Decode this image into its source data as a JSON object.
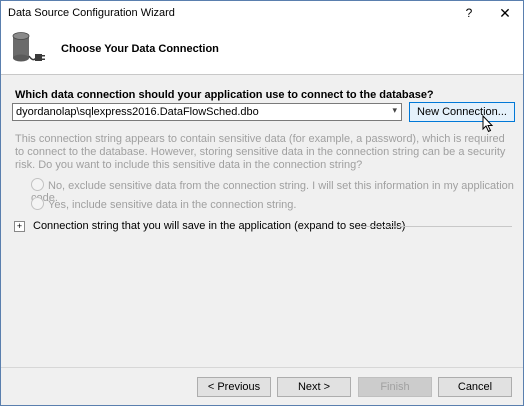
{
  "window": {
    "title": "Data Source Configuration Wizard",
    "help_label": "?",
    "close_label": "✕"
  },
  "header": {
    "title": "Choose Your Data Connection",
    "icon": "database-plug-icon"
  },
  "connection": {
    "question": "Which data connection should your application use to connect to the database?",
    "selected_value": "dyordanolap\\sqlexpress2016.DataFlowSched.dbo",
    "dropdown_arrow": "▾",
    "new_connection_label": "New Connection..."
  },
  "sensitive": {
    "info_text": "This connection string appears to contain sensitive data (for example, a password), which is required to connect to the database. However, storing sensitive data in the connection string can be a security risk. Do you want to include this sensitive data in the connection string?",
    "option_no": "No, exclude sensitive data from the connection string. I will set this information in my application code.",
    "option_yes": "Yes, include sensitive data in the connection string."
  },
  "expander": {
    "symbol": "+",
    "label": "Connection string that you will save in the application (expand to see details)"
  },
  "footer": {
    "previous_label": "< Previous",
    "next_label": "Next >",
    "finish_label": "Finish",
    "cancel_label": "Cancel"
  }
}
